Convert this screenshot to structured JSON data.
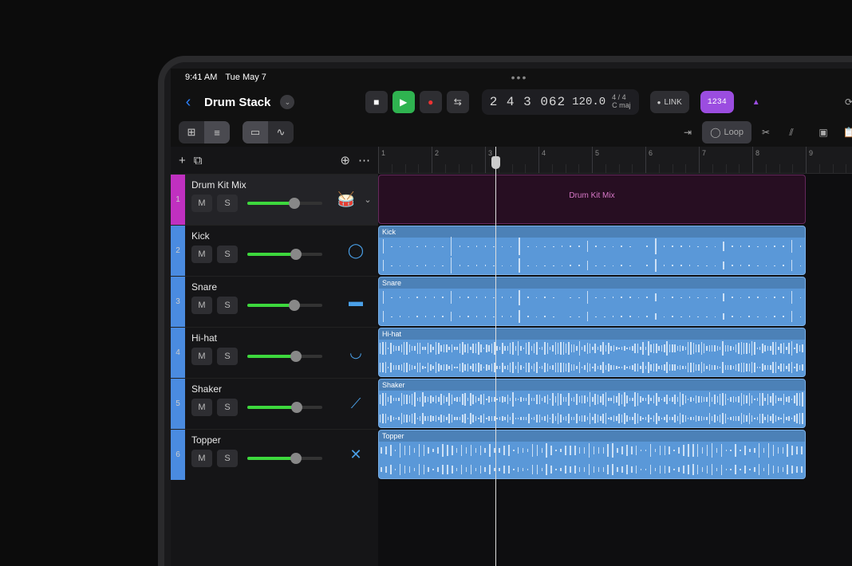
{
  "statusbar": {
    "time": "9:41 AM",
    "date": "Tue May 7"
  },
  "project": {
    "title": "Drum Stack"
  },
  "transport": {
    "position": "2 4 3 062",
    "tempo": "120.0",
    "timesig": "4 / 4",
    "key": "C maj",
    "link": "LINK",
    "countin": "1234"
  },
  "toolbar": {
    "loop": "Loop"
  },
  "ruler": {
    "bars": [
      1,
      2,
      3,
      4,
      5,
      6,
      7,
      8,
      9
    ]
  },
  "tracks": [
    {
      "num": "1",
      "name": "Drum Kit Mix",
      "color": "pink",
      "icon": "drumkit",
      "expandable": true,
      "fader": 60,
      "peak": 58,
      "selected": true,
      "regionLabel": "Drum Kit Mix",
      "regionType": "summary"
    },
    {
      "num": "2",
      "name": "Kick",
      "color": "blue",
      "icon": "kick",
      "fader": 62,
      "regionLabel": "Kick",
      "regionType": "audio",
      "density": "sparse"
    },
    {
      "num": "3",
      "name": "Snare",
      "color": "blue",
      "icon": "snare",
      "fader": 60,
      "regionLabel": "Snare",
      "regionType": "audio",
      "density": "sparse"
    },
    {
      "num": "4",
      "name": "Hi-hat",
      "color": "blue",
      "icon": "hihat",
      "fader": 62,
      "regionLabel": "Hi-hat",
      "regionType": "audio",
      "density": "dense"
    },
    {
      "num": "5",
      "name": "Shaker",
      "color": "blue",
      "icon": "shaker",
      "fader": 64,
      "regionLabel": "Shaker",
      "regionType": "audio",
      "density": "dense"
    },
    {
      "num": "6",
      "name": "Topper",
      "color": "blue",
      "icon": "topper",
      "fader": 62,
      "regionLabel": "Topper",
      "regionType": "audio",
      "density": "medium"
    }
  ],
  "labels": {
    "mute": "M",
    "solo": "S"
  },
  "playhead": {
    "barPos": 3.2
  }
}
